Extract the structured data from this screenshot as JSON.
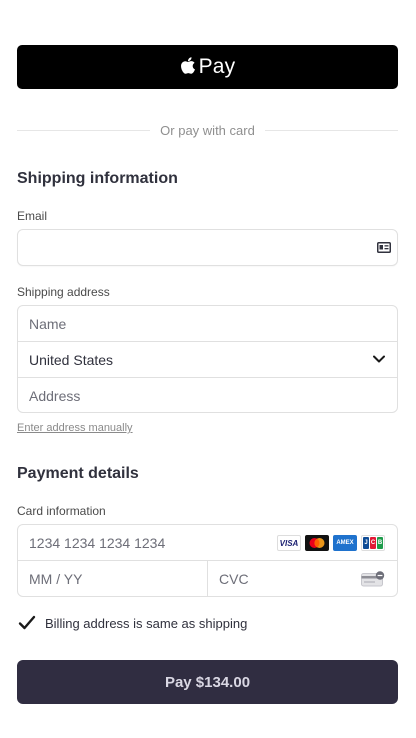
{
  "apple_pay": {
    "label": "Pay"
  },
  "divider": {
    "text": "Or pay with card"
  },
  "shipping": {
    "title": "Shipping information",
    "email_label": "Email",
    "email_value": "",
    "address_label": "Shipping address",
    "name_placeholder": "Name",
    "country_value": "United States",
    "address_placeholder": "Address",
    "manual_link": "Enter address manually"
  },
  "payment": {
    "title": "Payment details",
    "card_label": "Card information",
    "card_placeholder": "1234 1234 1234 1234",
    "expiry_placeholder": "MM / YY",
    "cvc_placeholder": "CVC",
    "brands": {
      "visa": "VISA",
      "amex": "AMEX",
      "jcb": [
        "J",
        "C",
        "B"
      ]
    }
  },
  "billing": {
    "label": "Billing address is same as shipping",
    "checked": true
  },
  "pay_button": {
    "label": "Pay $134.00"
  },
  "colors": {
    "apple_pay_bg": "#000000",
    "pay_button_bg": "#302d41",
    "border": "#e0e0e0"
  }
}
